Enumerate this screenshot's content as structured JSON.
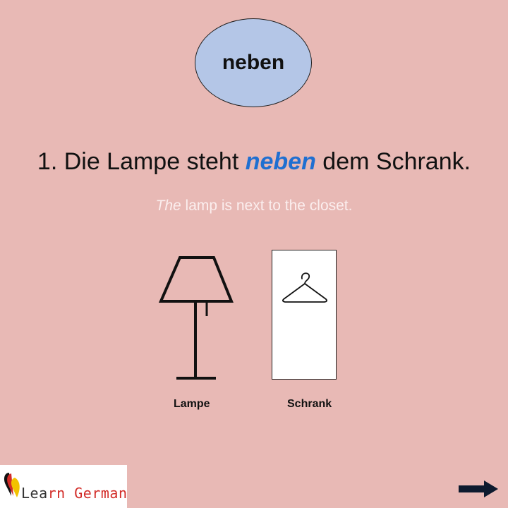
{
  "keyword": "neben",
  "sentence": {
    "before": "1. Die Lampe steht ",
    "highlight": "neben",
    "after": " dem Schrank."
  },
  "translation": {
    "italic": "The",
    "rest": " lamp is next to the closet."
  },
  "objects": {
    "lamp_label": "Lampe",
    "wardrobe_label": "Schrank"
  },
  "logo": {
    "text_a": "Lea",
    "text_b": "rn ",
    "text_c": "German"
  },
  "icons": {
    "lamp": "lamp-icon",
    "hanger": "hanger-icon",
    "next": "arrow-right-icon",
    "logo": "germany-flag-pin-icon"
  },
  "colors": {
    "background": "#e8b9b5",
    "ellipse": "#b4c6e7",
    "highlight": "#1f6fd1"
  }
}
